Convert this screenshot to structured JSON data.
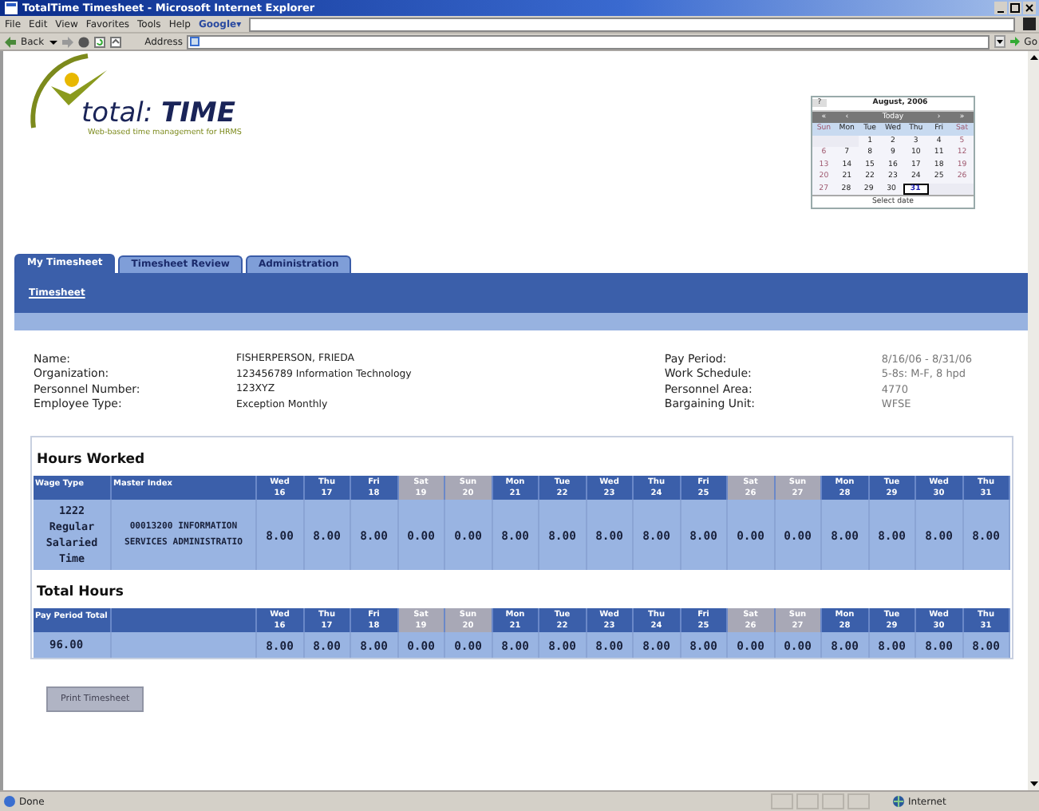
{
  "window": {
    "title": "TotalTime Timesheet - Microsoft Internet Explorer"
  },
  "menu": [
    "File",
    "Edit",
    "View",
    "Favorites",
    "Tools",
    "Help"
  ],
  "google": {
    "label": "Google▾"
  },
  "toolbar": {
    "back": "Back",
    "address_label": "Address",
    "go": "Go"
  },
  "logo": {
    "brand": "total: **TIME**",
    "tagline": "Web-based time management for HRMS"
  },
  "calendar": {
    "help": "?",
    "title": "August, 2006",
    "nav": [
      "«",
      "‹",
      "Today",
      "›",
      "»"
    ],
    "weekdays": [
      {
        "label": "Sun",
        "weekend": true
      },
      {
        "label": "Mon",
        "weekend": false
      },
      {
        "label": "Tue",
        "weekend": false
      },
      {
        "label": "Wed",
        "weekend": false
      },
      {
        "label": "Thu",
        "weekend": false
      },
      {
        "label": "Fri",
        "weekend": false
      },
      {
        "label": "Sat",
        "weekend": true
      }
    ],
    "weeks": [
      [
        {
          "kind": "blank"
        },
        {
          "kind": "blank"
        },
        {
          "day": "1",
          "selected": false
        },
        {
          "day": "2",
          "selected": false
        },
        {
          "day": "3",
          "selected": false
        },
        {
          "day": "4",
          "selected": false
        },
        {
          "day": "5",
          "selected": false
        }
      ],
      [
        {
          "day": "6",
          "selected": false
        },
        {
          "day": "7",
          "selected": false
        },
        {
          "day": "8",
          "selected": false
        },
        {
          "day": "9",
          "selected": false
        },
        {
          "day": "10",
          "selected": false
        },
        {
          "day": "11",
          "selected": false
        },
        {
          "day": "12",
          "selected": false
        }
      ],
      [
        {
          "day": "13",
          "selected": false
        },
        {
          "day": "14",
          "selected": false
        },
        {
          "day": "15",
          "selected": false
        },
        {
          "day": "16",
          "selected": false
        },
        {
          "day": "17",
          "selected": false
        },
        {
          "day": "18",
          "selected": false
        },
        {
          "day": "19",
          "selected": false
        }
      ],
      [
        {
          "day": "20",
          "selected": false
        },
        {
          "day": "21",
          "selected": false
        },
        {
          "day": "22",
          "selected": false
        },
        {
          "day": "23",
          "selected": false
        },
        {
          "day": "24",
          "selected": false
        },
        {
          "day": "25",
          "selected": false
        },
        {
          "day": "26",
          "selected": false
        }
      ],
      [
        {
          "day": "27",
          "selected": false
        },
        {
          "day": "28",
          "selected": false
        },
        {
          "day": "29",
          "selected": false
        },
        {
          "day": "30",
          "selected": false
        },
        {
          "day": "31",
          "selected": true
        },
        {
          "kind": "blank"
        },
        {
          "kind": "blank"
        }
      ]
    ],
    "footer": "Select date"
  },
  "tabs": [
    {
      "label": "My Timesheet",
      "selected": true
    },
    {
      "label": "Timesheet Review",
      "selected": false
    },
    {
      "label": "Administration",
      "selected": false
    }
  ],
  "subnav": [
    "Timesheet"
  ],
  "employee": {
    "left": [
      {
        "label": "Name:",
        "value": "FISHERPERSON, FRIEDA"
      },
      {
        "label": "Organization:",
        "value": "123456789 Information Technology"
      },
      {
        "label": "Personnel Number:",
        "value": "123XYZ"
      },
      {
        "label": "Employee Type:",
        "value": "Exception Monthly"
      }
    ],
    "right": [
      {
        "label": "Pay Period:",
        "value": "8/16/06 - 8/31/06"
      },
      {
        "label": "Work Schedule:",
        "value": "5-8s: M-F, 8 hpd"
      },
      {
        "label": "Personnel Area:",
        "value": "4770"
      },
      {
        "label": "Bargaining Unit:",
        "value": "WFSE"
      }
    ]
  },
  "hours_worked": {
    "title": "Hours Worked",
    "columns": [
      "Wage Type",
      "Master Index"
    ],
    "days": [
      {
        "dow": "Wed",
        "date": "16",
        "weekend": false
      },
      {
        "dow": "Thu",
        "date": "17",
        "weekend": false
      },
      {
        "dow": "Fri",
        "date": "18",
        "weekend": false
      },
      {
        "dow": "Sat",
        "date": "19",
        "weekend": true
      },
      {
        "dow": "Sun",
        "date": "20",
        "weekend": true
      },
      {
        "dow": "Mon",
        "date": "21",
        "weekend": false
      },
      {
        "dow": "Tue",
        "date": "22",
        "weekend": false
      },
      {
        "dow": "Wed",
        "date": "23",
        "weekend": false
      },
      {
        "dow": "Thu",
        "date": "24",
        "weekend": false
      },
      {
        "dow": "Fri",
        "date": "25",
        "weekend": false
      },
      {
        "dow": "Sat",
        "date": "26",
        "weekend": true
      },
      {
        "dow": "Sun",
        "date": "27",
        "weekend": true
      },
      {
        "dow": "Mon",
        "date": "28",
        "weekend": false
      },
      {
        "dow": "Tue",
        "date": "29",
        "weekend": false
      },
      {
        "dow": "Wed",
        "date": "30",
        "weekend": false
      },
      {
        "dow": "Thu",
        "date": "31",
        "weekend": false
      }
    ],
    "rows": [
      {
        "wage_type": "1222 Regular Salaried Time",
        "master_index": "00013200 INFORMATION SERVICES ADMINISTRATIO",
        "hours": [
          "8.00",
          "8.00",
          "8.00",
          "0.00",
          "0.00",
          "8.00",
          "8.00",
          "8.00",
          "8.00",
          "8.00",
          "0.00",
          "0.00",
          "8.00",
          "8.00",
          "8.00",
          "8.00"
        ]
      }
    ]
  },
  "total_hours": {
    "title": "Total Hours",
    "columns": [
      "Pay Period Total"
    ],
    "days": [
      {
        "dow": "Wed",
        "date": "16",
        "weekend": false
      },
      {
        "dow": "Thu",
        "date": "17",
        "weekend": false
      },
      {
        "dow": "Fri",
        "date": "18",
        "weekend": false
      },
      {
        "dow": "Sat",
        "date": "19",
        "weekend": true
      },
      {
        "dow": "Sun",
        "date": "20",
        "weekend": true
      },
      {
        "dow": "Mon",
        "date": "21",
        "weekend": false
      },
      {
        "dow": "Tue",
        "date": "22",
        "weekend": false
      },
      {
        "dow": "Wed",
        "date": "23",
        "weekend": false
      },
      {
        "dow": "Thu",
        "date": "24",
        "weekend": false
      },
      {
        "dow": "Fri",
        "date": "25",
        "weekend": false
      },
      {
        "dow": "Sat",
        "date": "26",
        "weekend": true
      },
      {
        "dow": "Sun",
        "date": "27",
        "weekend": true
      },
      {
        "dow": "Mon",
        "date": "28",
        "weekend": false
      },
      {
        "dow": "Tue",
        "date": "29",
        "weekend": false
      },
      {
        "dow": "Wed",
        "date": "30",
        "weekend": false
      },
      {
        "dow": "Thu",
        "date": "31",
        "weekend": false
      }
    ],
    "total": "96.00",
    "hours": [
      "8.00",
      "8.00",
      "8.00",
      "0.00",
      "0.00",
      "8.00",
      "8.00",
      "8.00",
      "8.00",
      "8.00",
      "0.00",
      "0.00",
      "8.00",
      "8.00",
      "8.00",
      "8.00"
    ]
  },
  "buttons": [
    "Print Timesheet"
  ],
  "status_bar": {
    "text": "Done",
    "zone": "Internet"
  }
}
